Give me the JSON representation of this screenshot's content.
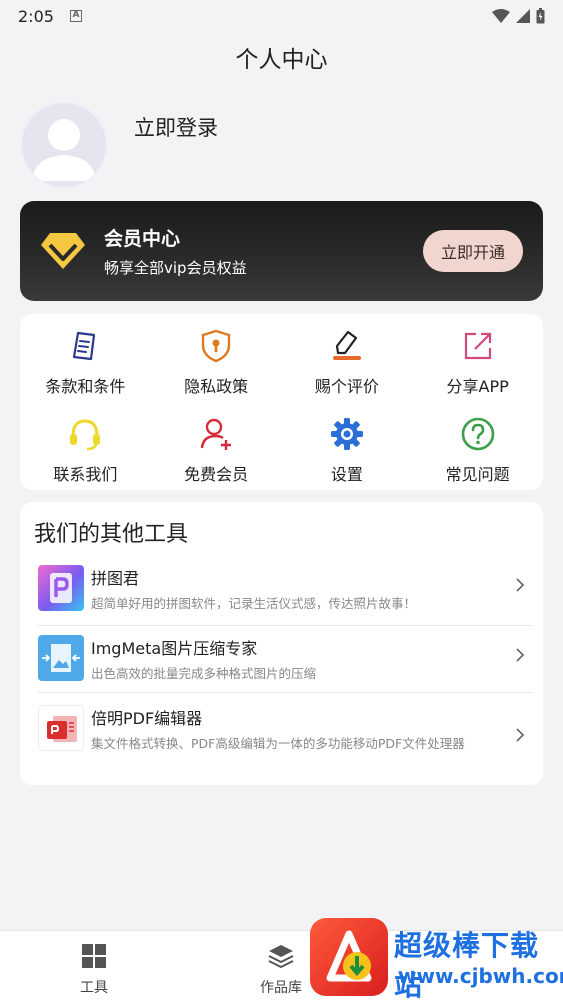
{
  "status_bar": {
    "time": "2:05",
    "notification_badge": "A"
  },
  "header": {
    "title": "个人中心"
  },
  "profile": {
    "login_label": "立即登录"
  },
  "vip": {
    "title": "会员中心",
    "subtitle": "畅享全部vip会员权益",
    "button_label": "立即开通"
  },
  "features": [
    {
      "label": "条款和条件",
      "icon": "document-icon"
    },
    {
      "label": "隐私政策",
      "icon": "shield-icon"
    },
    {
      "label": "赐个评价",
      "icon": "pen-icon"
    },
    {
      "label": "分享APP",
      "icon": "share-icon"
    },
    {
      "label": "联系我们",
      "icon": "headset-icon"
    },
    {
      "label": "免费会员",
      "icon": "add-user-icon"
    },
    {
      "label": "设置",
      "icon": "gear-icon"
    },
    {
      "label": "常见问题",
      "icon": "question-icon"
    }
  ],
  "tools": {
    "title": "我们的其他工具",
    "items": [
      {
        "name": "拼图君",
        "desc": "超简单好用的拼图软件，记录生活仪式感，传达照片故事！"
      },
      {
        "name": "ImgMeta图片压缩专家",
        "desc": "出色高效的批量完成多种格式图片的压缩"
      },
      {
        "name": "倍明PDF编辑器",
        "desc": "集文件格式转换、PDF高级编辑为一体的多功能移动PDF文件处理器"
      }
    ]
  },
  "bottom_nav": [
    {
      "label": "工具",
      "icon": "grid-icon"
    },
    {
      "label": "作品库",
      "icon": "layers-icon"
    }
  ],
  "watermark": {
    "line1": "超级棒下载站",
    "line2": "www.cjbwh.com"
  },
  "colors": {
    "background": "#f3f3f5",
    "vip_button": "#f1d6cf",
    "accent_blue": "#1e6fe0"
  }
}
